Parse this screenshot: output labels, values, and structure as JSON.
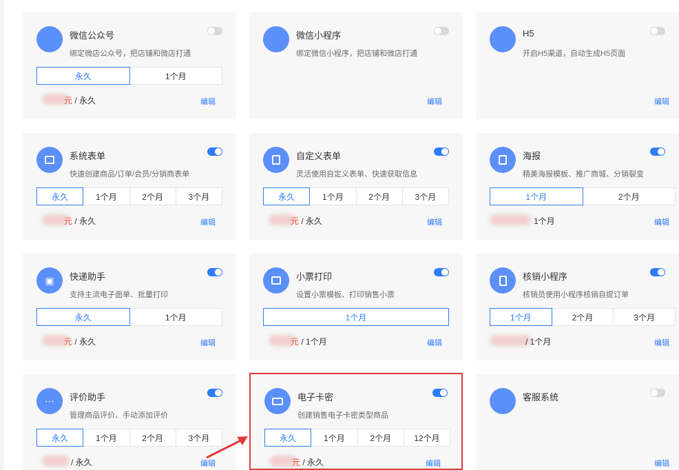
{
  "cards": [
    {
      "title": "微信公众号",
      "desc": "绑定微店公众号，把店铺和微店打通",
      "toggle": "off",
      "segments": [
        {
          "label": "永久",
          "active": true
        },
        {
          "label": "1个月",
          "active": false
        }
      ],
      "price_unit": "元",
      "price_suffix": " / 永久",
      "edit": "编辑"
    },
    {
      "title": "微信小程序",
      "desc": "绑定微信小程序，把店铺和微店打通",
      "toggle": "off",
      "edit": "编辑"
    },
    {
      "title": "H5",
      "desc": "开启H5渠道，自动生成H5页面",
      "toggle": "off",
      "edit": "编辑"
    },
    {
      "title": "系统表单",
      "desc": "快速创建商品/订单/会员/分销商表单",
      "toggle": "on",
      "segments": [
        {
          "label": "永久",
          "active": true
        },
        {
          "label": "1个月",
          "active": false
        },
        {
          "label": "2个月",
          "active": false
        },
        {
          "label": "3个月",
          "active": false
        }
      ],
      "price_unit": "元",
      "price_suffix": " / 永久",
      "edit": "编辑"
    },
    {
      "title": "自定义表单",
      "desc": "灵活使用自定义表单、快速获取信息",
      "toggle": "on",
      "segments": [
        {
          "label": "永久",
          "active": true
        },
        {
          "label": "1个月",
          "active": false
        },
        {
          "label": "2个月",
          "active": false
        },
        {
          "label": "3个月",
          "active": false
        }
      ],
      "price_unit": "元",
      "price_suffix": " / 永久",
      "edit": "编辑"
    },
    {
      "title": "海报",
      "desc": "精美海报模板、推广商城、分销裂变",
      "toggle": "on",
      "segments": [
        {
          "label": "1个月",
          "active": true
        },
        {
          "label": "2个月",
          "active": false
        }
      ],
      "price_unit": "",
      "price_suffix": "1个月",
      "edit": "编辑"
    },
    {
      "title": "快递助手",
      "desc": "支持主流电子面单、批量打印",
      "toggle": "on",
      "segments": [
        {
          "label": "永久",
          "active": true
        },
        {
          "label": "1个月",
          "active": false
        }
      ],
      "price_unit": "元",
      "price_suffix": " / 永久",
      "edit": "编辑"
    },
    {
      "title": "小票打印",
      "desc": "设置小票模板、打印销售小票",
      "toggle": "on",
      "segments": [
        {
          "label": "1个月",
          "active": true
        }
      ],
      "price_unit": "元",
      "price_suffix": " / 1个月",
      "edit": "编辑"
    },
    {
      "title": "核销小程序",
      "desc": "核销员使用小程序核销自提订单",
      "toggle": "on",
      "segments": [
        {
          "label": "1个月",
          "active": true
        },
        {
          "label": "2个月",
          "active": false
        },
        {
          "label": "3个月",
          "active": false
        }
      ],
      "price_unit": "",
      "price_suffix": " / 1个月",
      "edit": "编辑"
    },
    {
      "title": "评价助手",
      "desc": "管理商品评价、手动添加评价",
      "toggle": "on",
      "segments": [
        {
          "label": "永久",
          "active": true
        },
        {
          "label": "1个月",
          "active": false
        },
        {
          "label": "2个月",
          "active": false
        },
        {
          "label": "3个月",
          "active": false
        }
      ],
      "price_unit": "",
      "price_suffix": " / 永久",
      "edit": "编辑"
    },
    {
      "title": "电子卡密",
      "desc": "创建销售电子卡密类型商品",
      "toggle": "on",
      "segments": [
        {
          "label": "永久",
          "active": true
        },
        {
          "label": "1个月",
          "active": false
        },
        {
          "label": "2个月",
          "active": false
        },
        {
          "label": "12个月",
          "active": false
        }
      ],
      "price_unit": "元",
      "price_suffix": " / 永久",
      "edit": "编辑"
    },
    {
      "title": "客服系统",
      "desc": "",
      "toggle": "off",
      "edit": "编辑"
    }
  ],
  "colors": {
    "accent": "#2f7cf6",
    "highlight": "#e23a3a",
    "price": "#e35b3b",
    "avatar": "#5b8ff9"
  }
}
